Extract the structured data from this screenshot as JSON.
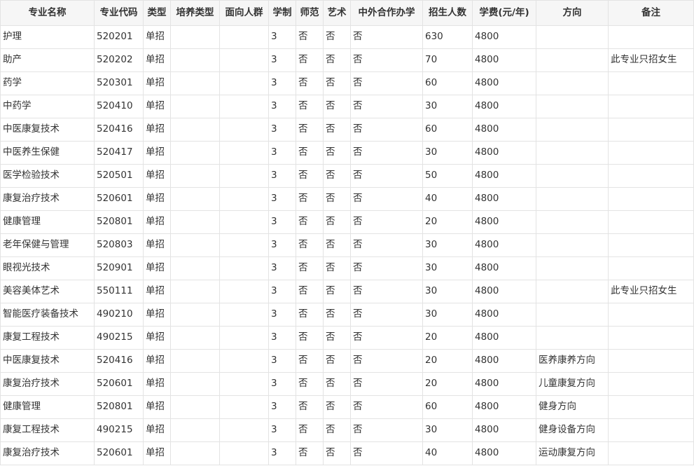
{
  "table": {
    "headers": [
      "专业名称",
      "专业代码",
      "类型",
      "培养类型",
      "面向人群",
      "学制",
      "师范",
      "艺术",
      "中外合作办学",
      "招生人数",
      "学费(元/年)",
      "方向",
      "备注"
    ],
    "rows": [
      [
        "护理",
        "520201",
        "单招",
        "",
        "",
        "3",
        "否",
        "否",
        "否",
        "630",
        "4800",
        "",
        ""
      ],
      [
        "助产",
        "520202",
        "单招",
        "",
        "",
        "3",
        "否",
        "否",
        "否",
        "70",
        "4800",
        "",
        "此专业只招女生"
      ],
      [
        "药学",
        "520301",
        "单招",
        "",
        "",
        "3",
        "否",
        "否",
        "否",
        "60",
        "4800",
        "",
        ""
      ],
      [
        "中药学",
        "520410",
        "单招",
        "",
        "",
        "3",
        "否",
        "否",
        "否",
        "30",
        "4800",
        "",
        ""
      ],
      [
        "中医康复技术",
        "520416",
        "单招",
        "",
        "",
        "3",
        "否",
        "否",
        "否",
        "60",
        "4800",
        "",
        ""
      ],
      [
        "中医养生保健",
        "520417",
        "单招",
        "",
        "",
        "3",
        "否",
        "否",
        "否",
        "30",
        "4800",
        "",
        ""
      ],
      [
        "医学检验技术",
        "520501",
        "单招",
        "",
        "",
        "3",
        "否",
        "否",
        "否",
        "50",
        "4800",
        "",
        ""
      ],
      [
        "康复治疗技术",
        "520601",
        "单招",
        "",
        "",
        "3",
        "否",
        "否",
        "否",
        "40",
        "4800",
        "",
        ""
      ],
      [
        "健康管理",
        "520801",
        "单招",
        "",
        "",
        "3",
        "否",
        "否",
        "否",
        "20",
        "4800",
        "",
        ""
      ],
      [
        "老年保健与管理",
        "520803",
        "单招",
        "",
        "",
        "3",
        "否",
        "否",
        "否",
        "30",
        "4800",
        "",
        ""
      ],
      [
        "眼视光技术",
        "520901",
        "单招",
        "",
        "",
        "3",
        "否",
        "否",
        "否",
        "30",
        "4800",
        "",
        ""
      ],
      [
        "美容美体艺术",
        "550111",
        "单招",
        "",
        "",
        "3",
        "否",
        "否",
        "否",
        "30",
        "4800",
        "",
        "此专业只招女生"
      ],
      [
        "智能医疗装备技术",
        "490210",
        "单招",
        "",
        "",
        "3",
        "否",
        "否",
        "否",
        "30",
        "4800",
        "",
        ""
      ],
      [
        "康复工程技术",
        "490215",
        "单招",
        "",
        "",
        "3",
        "否",
        "否",
        "否",
        "20",
        "4800",
        "",
        ""
      ],
      [
        "中医康复技术",
        "520416",
        "单招",
        "",
        "",
        "3",
        "否",
        "否",
        "否",
        "20",
        "4800",
        "医养康养方向",
        ""
      ],
      [
        "康复治疗技术",
        "520601",
        "单招",
        "",
        "",
        "3",
        "否",
        "否",
        "否",
        "20",
        "4800",
        "儿童康复方向",
        ""
      ],
      [
        "健康管理",
        "520801",
        "单招",
        "",
        "",
        "3",
        "否",
        "否",
        "否",
        "60",
        "4800",
        "健身方向",
        ""
      ],
      [
        "康复工程技术",
        "490215",
        "单招",
        "",
        "",
        "3",
        "否",
        "否",
        "否",
        "30",
        "4800",
        "健身设备方向",
        ""
      ],
      [
        "康复治疗技术",
        "520601",
        "单招",
        "",
        "",
        "3",
        "否",
        "否",
        "否",
        "40",
        "4800",
        "运动康复方向",
        ""
      ]
    ]
  }
}
